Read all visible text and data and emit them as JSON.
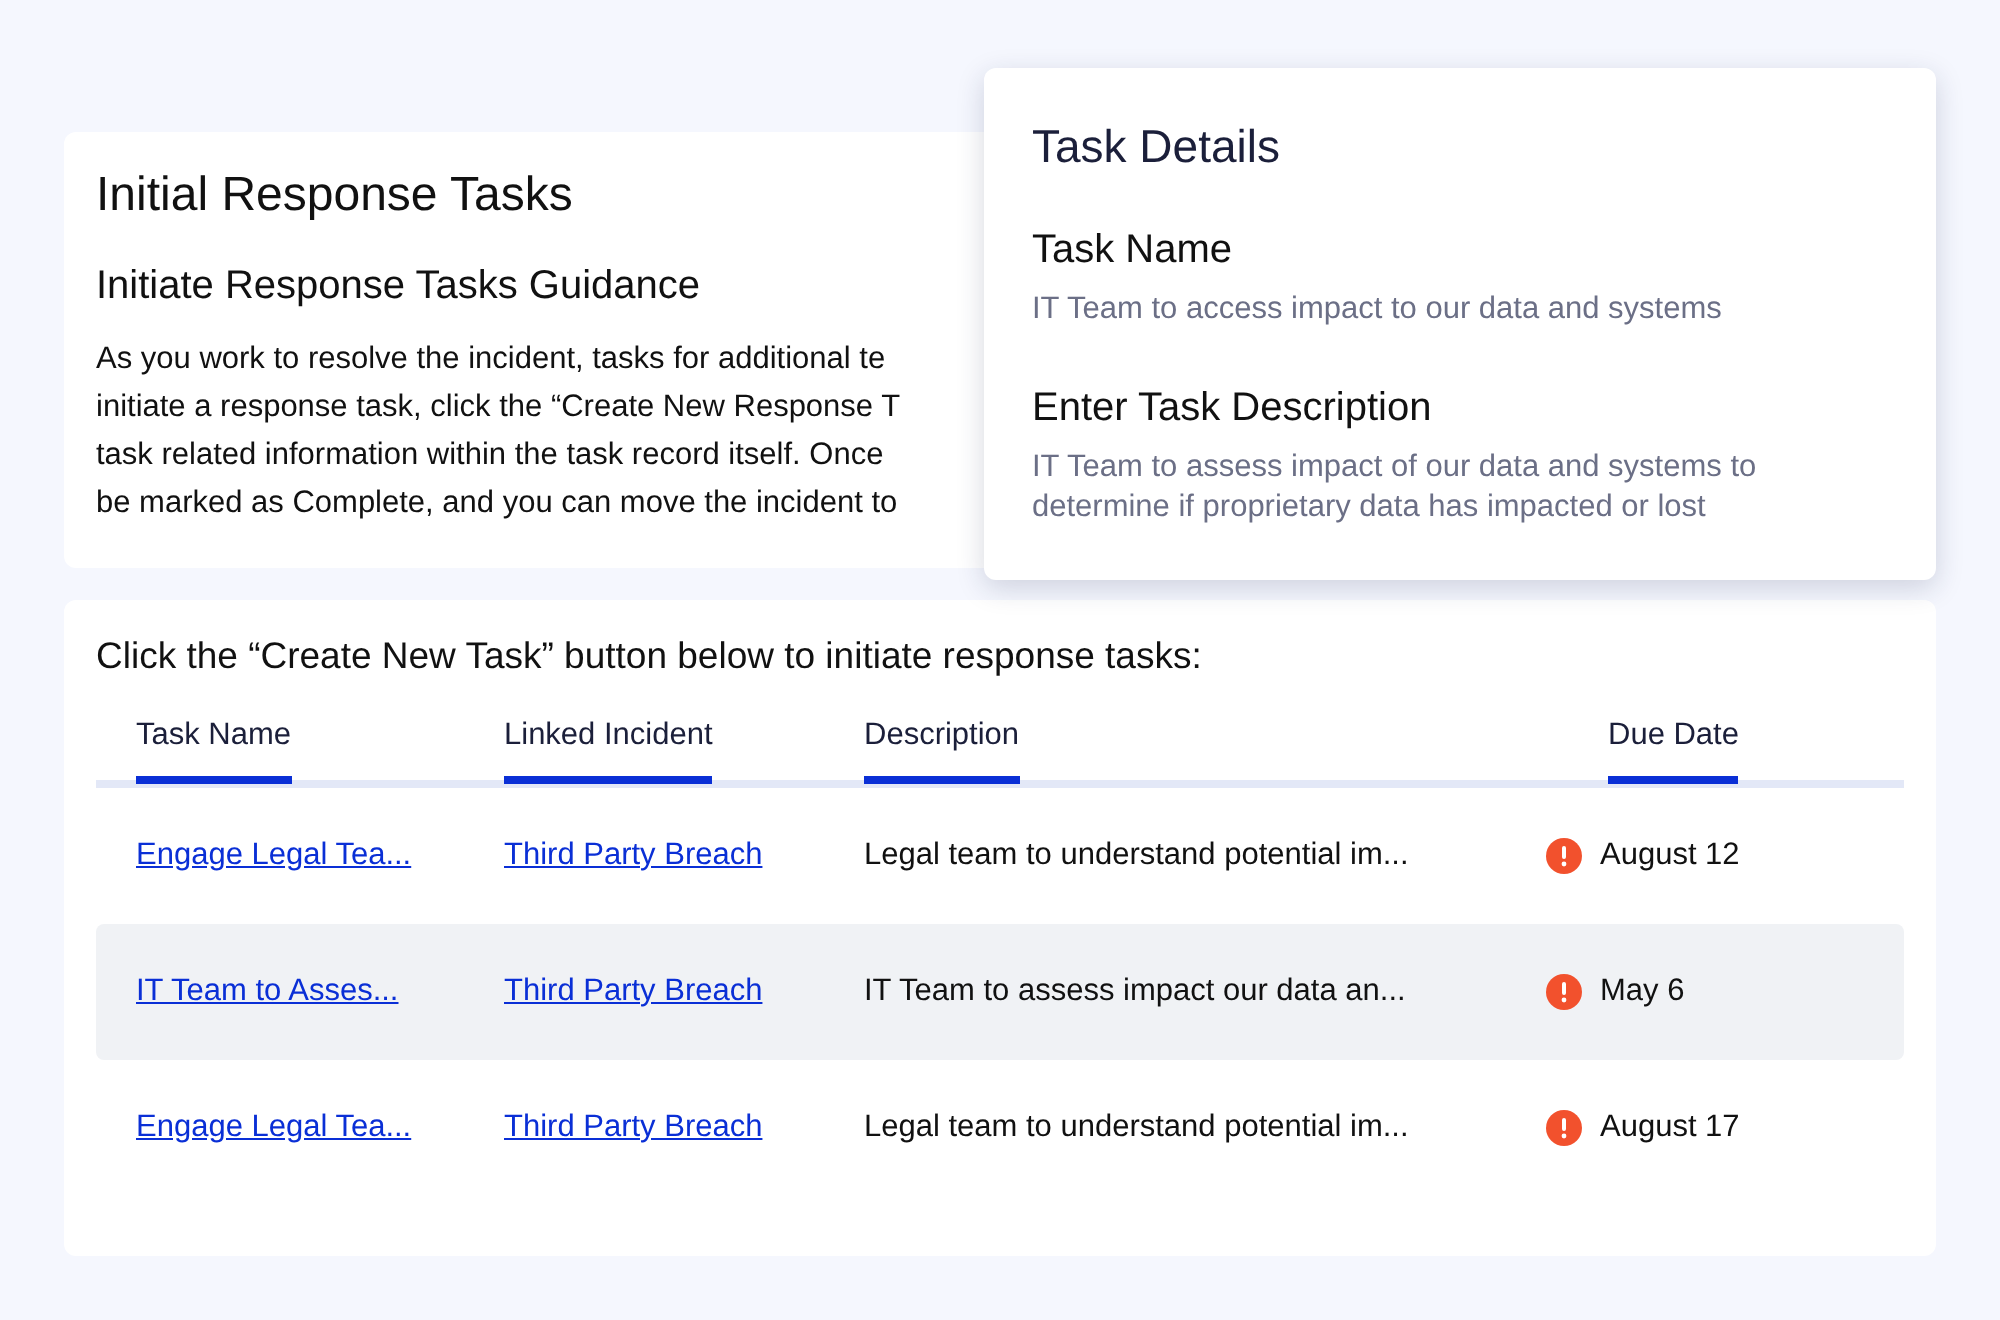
{
  "guidance_card": {
    "title": "Initial Response Tasks",
    "subtitle": "Initiate Response Tasks Guidance",
    "paragraph_lines": [
      "As you work to resolve the incident, tasks for additional te",
      "initiate a response task, click the “Create New Response T",
      "task related information within the task record itself. Once",
      "be marked as Complete, and you can move the incident to"
    ]
  },
  "tasks_card": {
    "instruction": "Click the “Create New Task” button below to initiate response tasks:",
    "table": {
      "columns": [
        "Task Name",
        "Linked Incident",
        "Description",
        "Due Date"
      ],
      "rows": [
        {
          "task_name": "Engage Legal Tea...",
          "linked_incident": "Third Party Breach",
          "description": "Legal team to understand potential im...",
          "due_date": "August 12",
          "overdue": true,
          "selected": false
        },
        {
          "task_name": "IT Team to Asses...",
          "linked_incident": "Third Party Breach",
          "description": "IT Team to assess impact our data an...",
          "due_date": "May 6",
          "overdue": true,
          "selected": true
        },
        {
          "task_name": "Engage Legal Tea...",
          "linked_incident": "Third Party Breach",
          "description": "Legal team to understand potential im...",
          "due_date": "August 17",
          "overdue": true,
          "selected": false
        }
      ]
    }
  },
  "task_details": {
    "title": "Task Details",
    "fields": [
      {
        "label": "Task Name",
        "value": "IT Team to access impact to our data and systems"
      },
      {
        "label": "Enter Task Description",
        "value": "IT Team to assess impact of our data and systems to determine if proprietary data has impacted or lost"
      }
    ]
  }
}
